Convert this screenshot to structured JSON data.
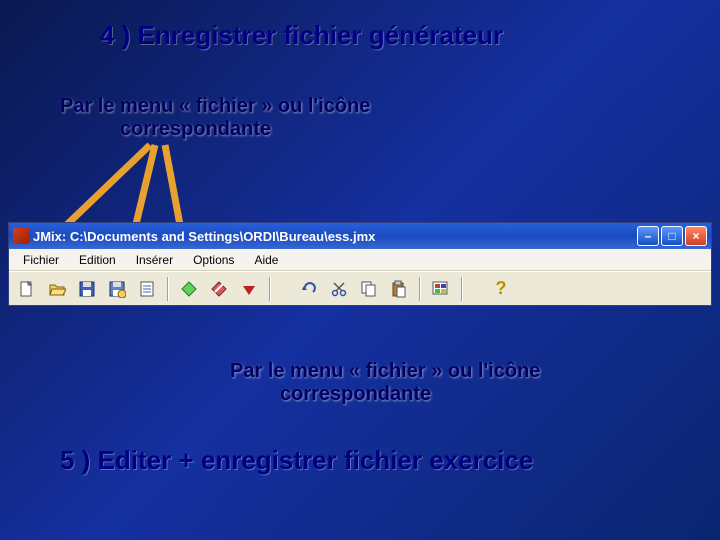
{
  "title": "4 )  Enregistrer fichier générateur",
  "caption1": {
    "line1": "Par le menu «  fichier » ou l'icône",
    "line2": "correspondante"
  },
  "caption2": {
    "line1": "Par le menu «  fichier » ou l'icône",
    "line2": "correspondante"
  },
  "step5": "5 ) Editer  + enregistrer fichier exercice",
  "window": {
    "title": "JMix: C:\\Documents and Settings\\ORDI\\Bureau\\ess.jmx",
    "btn_min": "–",
    "btn_max": "□",
    "btn_close": "×"
  },
  "menu": {
    "fichier": "Fichier",
    "edition": "Edition",
    "inserer": "Insérer",
    "options": "Options",
    "aide": "Aide"
  },
  "help_mark": "?"
}
